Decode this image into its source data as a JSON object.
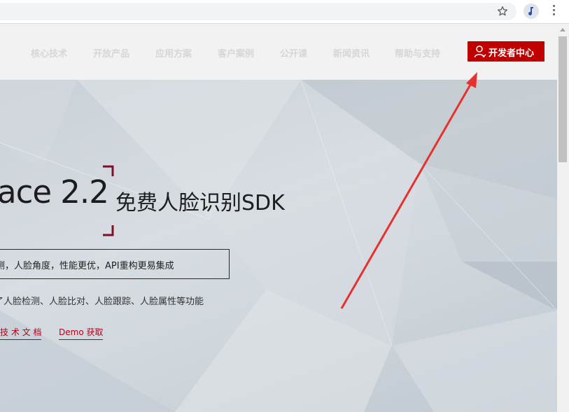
{
  "browser": {
    "accent": "#5f6368"
  },
  "nav": {
    "items": [
      "核心技术",
      "开放产品",
      "应用方案",
      "客户案例",
      "公开课",
      "新闻资讯",
      "帮助与支持"
    ],
    "cta_label": "开发者中心",
    "cta_color": "#c00000"
  },
  "hero": {
    "title": "ace 2.2",
    "subtitle": "免费人脸识别SDK",
    "feature": "测，人脸角度，性能更优，API重构更易集成",
    "description": "了人脸检测、人脸比对、人脸跟踪、人脸属性等功能",
    "links": [
      "技 术 文 档",
      "Demo 获取"
    ],
    "link_color": "#b3001b"
  },
  "annotation": {
    "arrow_color": "#e8302e"
  }
}
